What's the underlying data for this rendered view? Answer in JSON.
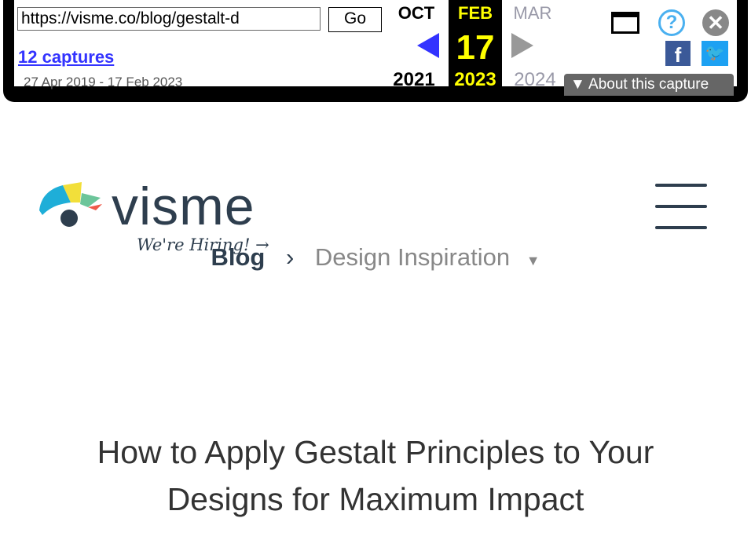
{
  "wayback": {
    "url": "https://visme.co/blog/gestalt-d",
    "go": "Go",
    "captures": "12 captures",
    "range": "27 Apr 2019 - 17 Feb 2023",
    "prev": {
      "month": "OCT",
      "year": "2021"
    },
    "cur": {
      "month": "FEB",
      "day": "17",
      "year": "2023"
    },
    "next": {
      "month": "MAR",
      "year": "2024"
    },
    "about": "About this capture"
  },
  "site": {
    "logo": "visme",
    "hiring": "We're Hiring! →"
  },
  "breadcrumb": {
    "blog": "Blog",
    "category": "Design Inspiration"
  },
  "article": {
    "title": "How to Apply Gestalt Principles to Your Designs for Maximum Impact"
  },
  "colors": {
    "text": "#2e3e4e",
    "wayback_link": "#3333ff",
    "year_current": "#ffff00"
  }
}
